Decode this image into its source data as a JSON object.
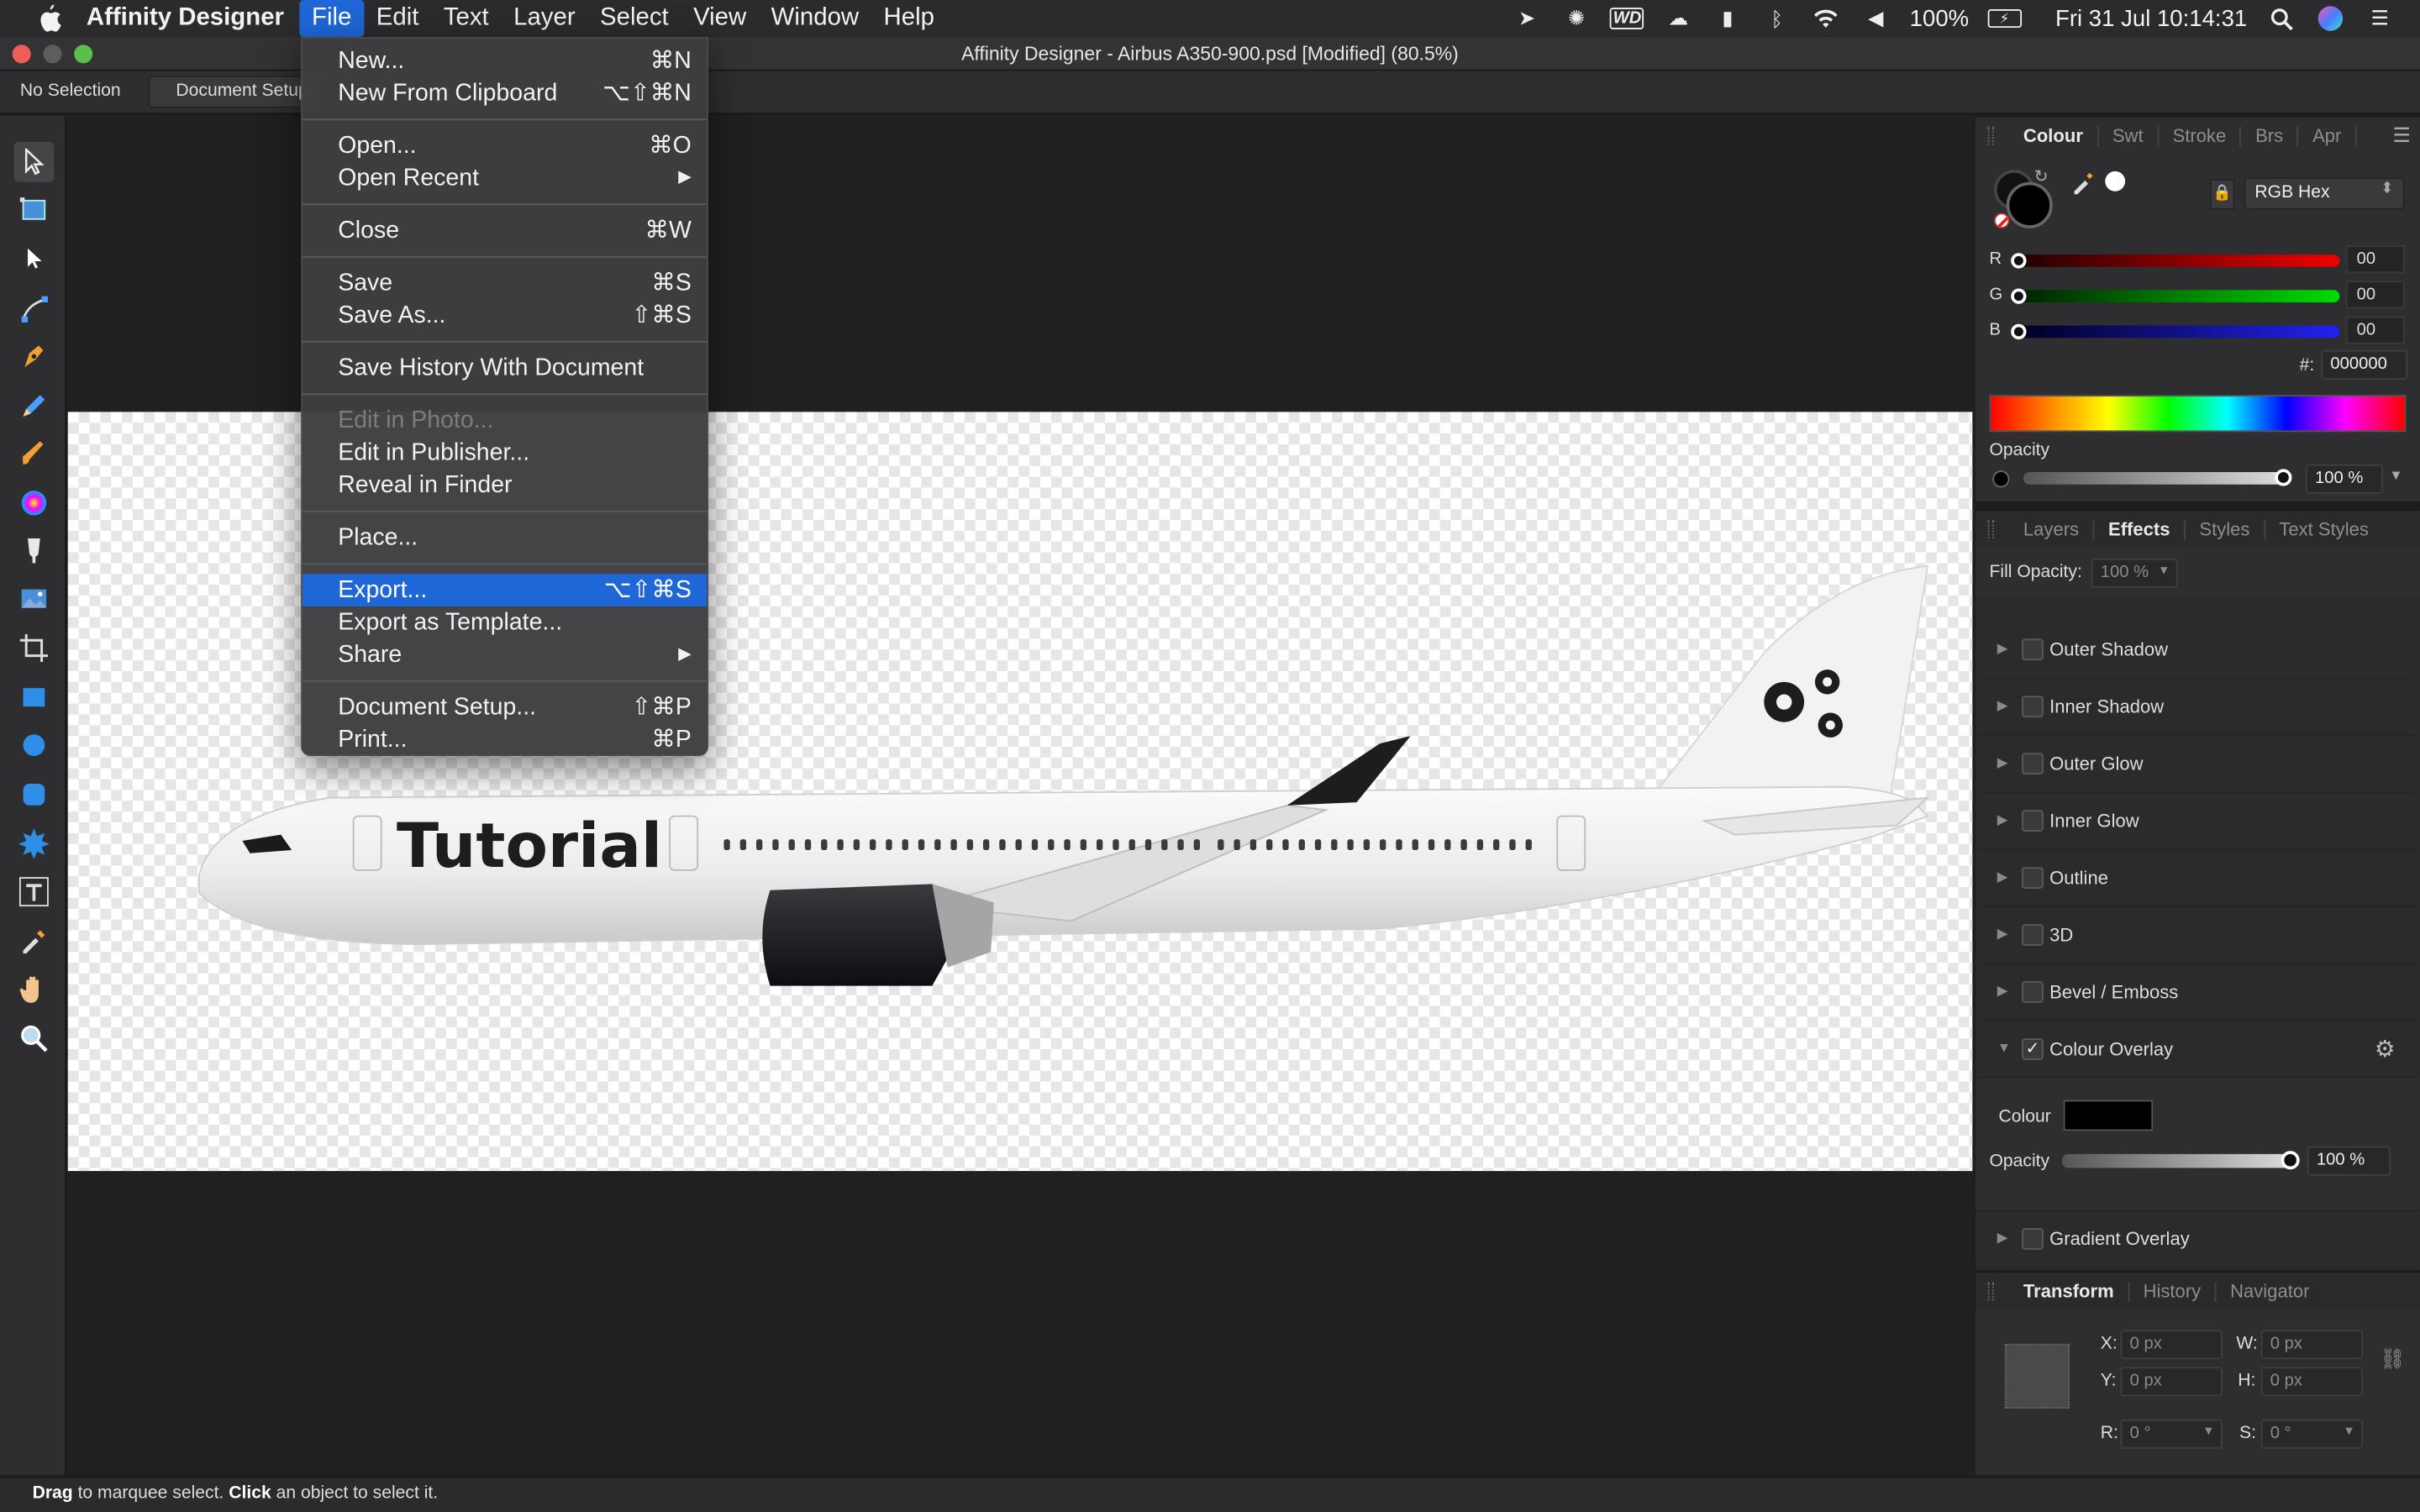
{
  "menubar": {
    "app_name": "Affinity Designer",
    "items": [
      "File",
      "Edit",
      "Text",
      "Layer",
      "Select",
      "View",
      "Window",
      "Help"
    ],
    "active_item": "File",
    "battery": "100%",
    "datetime": "Fri 31 Jul  10:14:31"
  },
  "window": {
    "title": "Affinity Designer - Airbus A350-900.psd [Modified] (80.5%)"
  },
  "context_toolbar": {
    "selection": "No Selection",
    "document_setup": "Document Setup..."
  },
  "file_menu": {
    "groups": [
      [
        {
          "label": "New...",
          "shortcut": "⌘N"
        },
        {
          "label": "New From Clipboard",
          "shortcut": "⌥⇧⌘N"
        }
      ],
      [
        {
          "label": "Open...",
          "shortcut": "⌘O"
        },
        {
          "label": "Open Recent",
          "shortcut": "▶"
        }
      ],
      [
        {
          "label": "Close",
          "shortcut": "⌘W"
        }
      ],
      [
        {
          "label": "Save",
          "shortcut": "⌘S"
        },
        {
          "label": "Save As...",
          "shortcut": "⇧⌘S"
        }
      ],
      [
        {
          "label": "Save History With Document",
          "shortcut": ""
        }
      ],
      [
        {
          "label": "Edit in Photo...",
          "shortcut": "",
          "disabled": true
        },
        {
          "label": "Edit in Publisher...",
          "shortcut": ""
        },
        {
          "label": "Reveal in Finder",
          "shortcut": ""
        }
      ],
      [
        {
          "label": "Place...",
          "shortcut": ""
        }
      ],
      [
        {
          "label": "Export...",
          "shortcut": "⌥⇧⌘S",
          "highlighted": true
        },
        {
          "label": "Export as Template...",
          "shortcut": ""
        },
        {
          "label": "Share",
          "shortcut": "▶"
        }
      ],
      [
        {
          "label": "Document Setup...",
          "shortcut": "⇧⌘P"
        },
        {
          "label": "Print...",
          "shortcut": "⌘P"
        }
      ]
    ]
  },
  "artwork": {
    "fuselage_text": "Tutorial"
  },
  "colour_panel": {
    "tabs": [
      "Colour",
      "Swt",
      "Stroke",
      "Brs",
      "Apr"
    ],
    "active_tab": "Colour",
    "model": "RGB Hex",
    "r": "00",
    "g": "00",
    "b": "00",
    "hex_label": "#:",
    "hex": "000000",
    "opacity_label": "Opacity",
    "opacity": "100 %"
  },
  "effects_panel": {
    "tabs": [
      "Layers",
      "Effects",
      "Styles",
      "Text Styles"
    ],
    "active_tab": "Effects",
    "fill_opacity_label": "Fill Opacity:",
    "fill_opacity": "100 %",
    "effects": [
      {
        "name": "Outer Shadow",
        "checked": false
      },
      {
        "name": "Inner Shadow",
        "checked": false
      },
      {
        "name": "Outer Glow",
        "checked": false
      },
      {
        "name": "Inner Glow",
        "checked": false
      },
      {
        "name": "Outline",
        "checked": false
      },
      {
        "name": "3D",
        "checked": false
      },
      {
        "name": "Bevel / Emboss",
        "checked": false
      },
      {
        "name": "Colour Overlay",
        "checked": true
      }
    ],
    "overlay_colour_label": "Colour",
    "overlay_colour": "#000000",
    "overlay_opacity_label": "Opacity",
    "overlay_opacity": "100 %",
    "last_effect": "Gradient Overlay"
  },
  "transform_panel": {
    "tabs": [
      "Transform",
      "History",
      "Navigator"
    ],
    "active_tab": "Transform",
    "x_label": "X:",
    "x": "0 px",
    "y_label": "Y:",
    "y": "0 px",
    "w_label": "W:",
    "w": "0 px",
    "h_label": "H:",
    "h": "0 px",
    "r_label": "R:",
    "r": "0 °",
    "s_label": "S:",
    "s": "0 °"
  },
  "statusbar": {
    "hint_1_key": "Drag",
    "hint_1": " to marquee select. ",
    "hint_2_key": "Click",
    "hint_2": " an object to select it."
  },
  "colors": {
    "accent": "#1f66d6",
    "panel_bg": "#2e2e30",
    "canvas_bg": "#202020"
  }
}
